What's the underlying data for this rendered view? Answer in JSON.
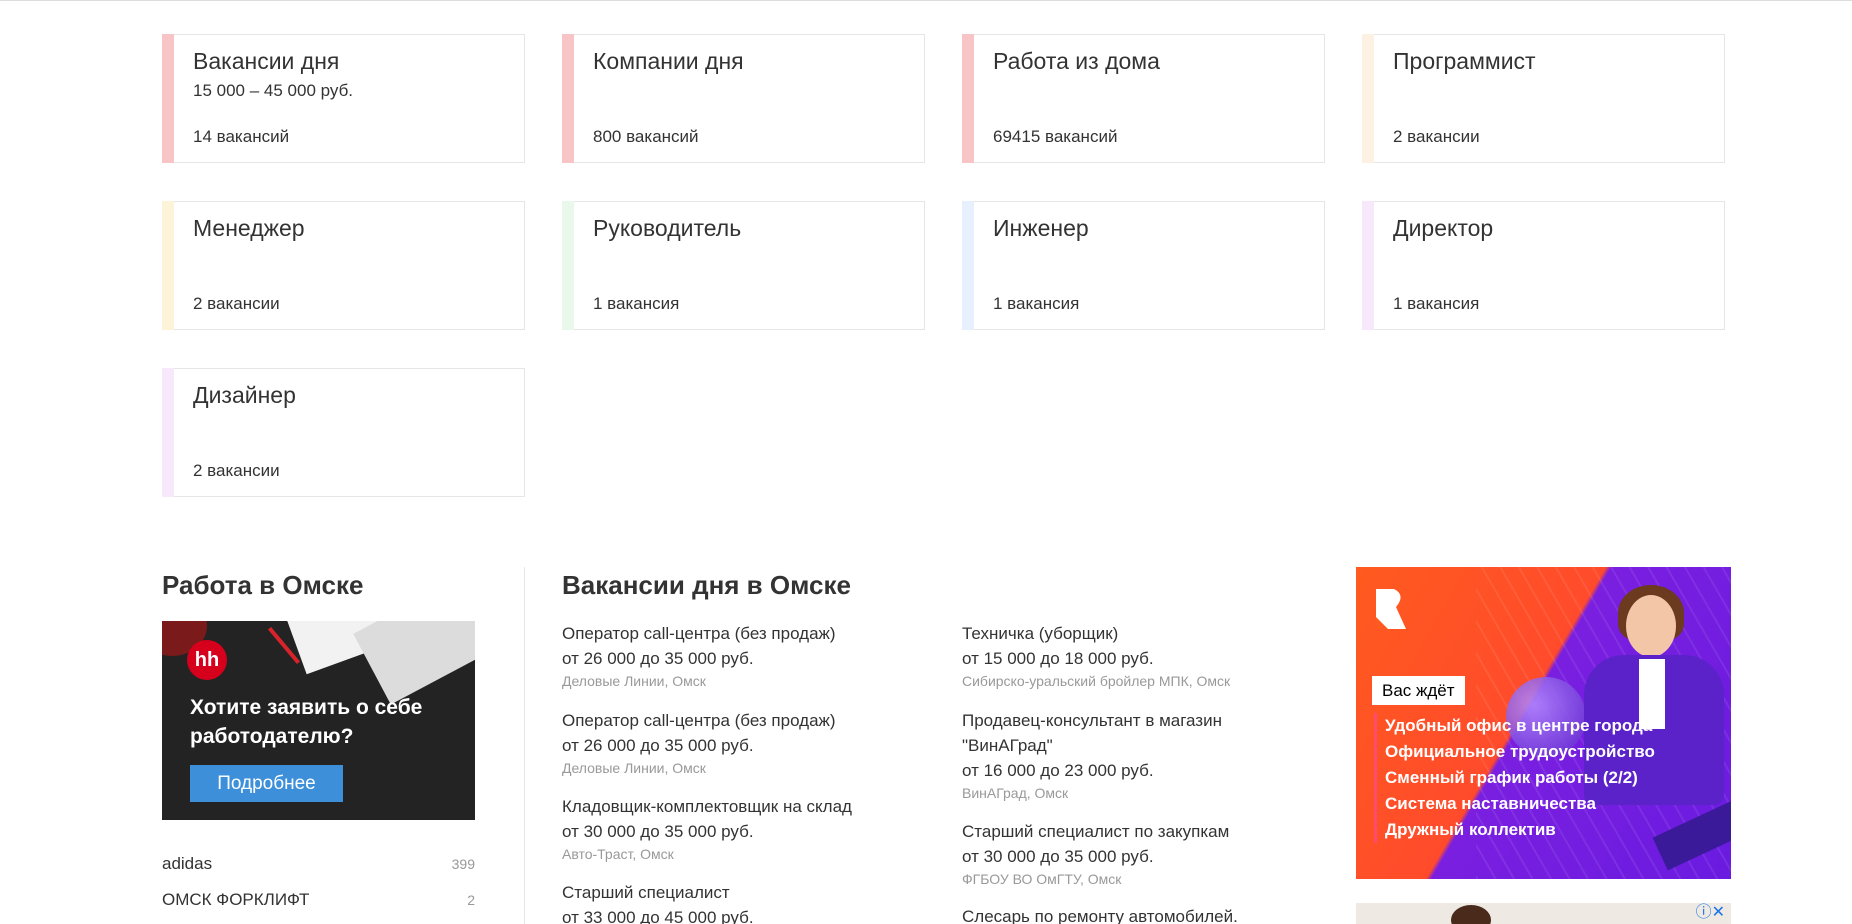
{
  "cards": [
    {
      "title": "Вакансии дня",
      "salary": "15 000 – 45 000 руб.",
      "count": "14 вакансий",
      "color": "#f8c5c7"
    },
    {
      "title": "Компании дня",
      "salary": "",
      "count": "800 вакансий",
      "color": "#f8c5c7"
    },
    {
      "title": "Работа из дома",
      "salary": "",
      "count": "69415 вакансий",
      "color": "#f8c5c7"
    },
    {
      "title": "Программист",
      "salary": "",
      "count": "2 вакансии",
      "color": "#fdf1e4"
    },
    {
      "title": "Менеджер",
      "salary": "",
      "count": "2 вакансии",
      "color": "#fdf3d9"
    },
    {
      "title": "Руководитель",
      "salary": "",
      "count": "1 вакансия",
      "color": "#e8f8ea"
    },
    {
      "title": "Инженер",
      "salary": "",
      "count": "1 вакансия",
      "color": "#e6f1fd"
    },
    {
      "title": "Директор",
      "salary": "",
      "count": "1 вакансия",
      "color": "#f8e8fb"
    },
    {
      "title": "Дизайнер",
      "salary": "",
      "count": "2 вакансии",
      "color": "#f8e8fb"
    }
  ],
  "left_section": {
    "title": "Работа в Омске",
    "banner": {
      "logo": "hh",
      "text": "Хотите заявить о себе работодателю?",
      "button": "Подробнее"
    },
    "companies": [
      {
        "name": "adidas",
        "count": "399"
      },
      {
        "name": "ОМСК ФОРКЛИФТ",
        "count": "2"
      }
    ]
  },
  "vacancies_section": {
    "title": "Вакансии дня в Омске",
    "col1": [
      {
        "title": "Оператор call-центра (без продаж)",
        "salary": "от 26 000 до 35 000 руб.",
        "company": "Деловые Линии, Омск"
      },
      {
        "title": "Оператор call-центра (без продаж)",
        "salary": "от 26 000 до 35 000 руб.",
        "company": "Деловые Линии, Омск"
      },
      {
        "title": "Кладовщик-комплектовщик на склад",
        "salary": "от 30 000 до 35 000 руб.",
        "company": "Авто-Траст, Омск"
      },
      {
        "title": "Старший специалист",
        "salary": "от 33 000 до 45 000 руб.",
        "company": ""
      }
    ],
    "col2": [
      {
        "title": "Техничка (уборщик)",
        "salary": "от 15 000 до 18 000 руб.",
        "company": "Сибирско-уральский бройлер МПК, Омск"
      },
      {
        "title": "Продавец-консультант в магазин \"ВинАГрад\"",
        "salary": "от 16 000 до 23 000 руб.",
        "company": "ВинАГрад, Омск"
      },
      {
        "title": "Старший специалист по закупкам",
        "salary": "от 30 000 до 35 000 руб.",
        "company": "ФГБОУ ВО ОмГТУ, Омск"
      },
      {
        "title": "Слесарь по ремонту автомобилей.",
        "salary": "",
        "company": ""
      }
    ]
  },
  "ad": {
    "badge": "Вас ждёт",
    "items": [
      "Удобный офис в центре города",
      "Официальное трудоустройство",
      "Сменный график работы (2/2)",
      "Система наставничества",
      "Дружный коллектив"
    ],
    "controls": "ⓘ✕"
  }
}
